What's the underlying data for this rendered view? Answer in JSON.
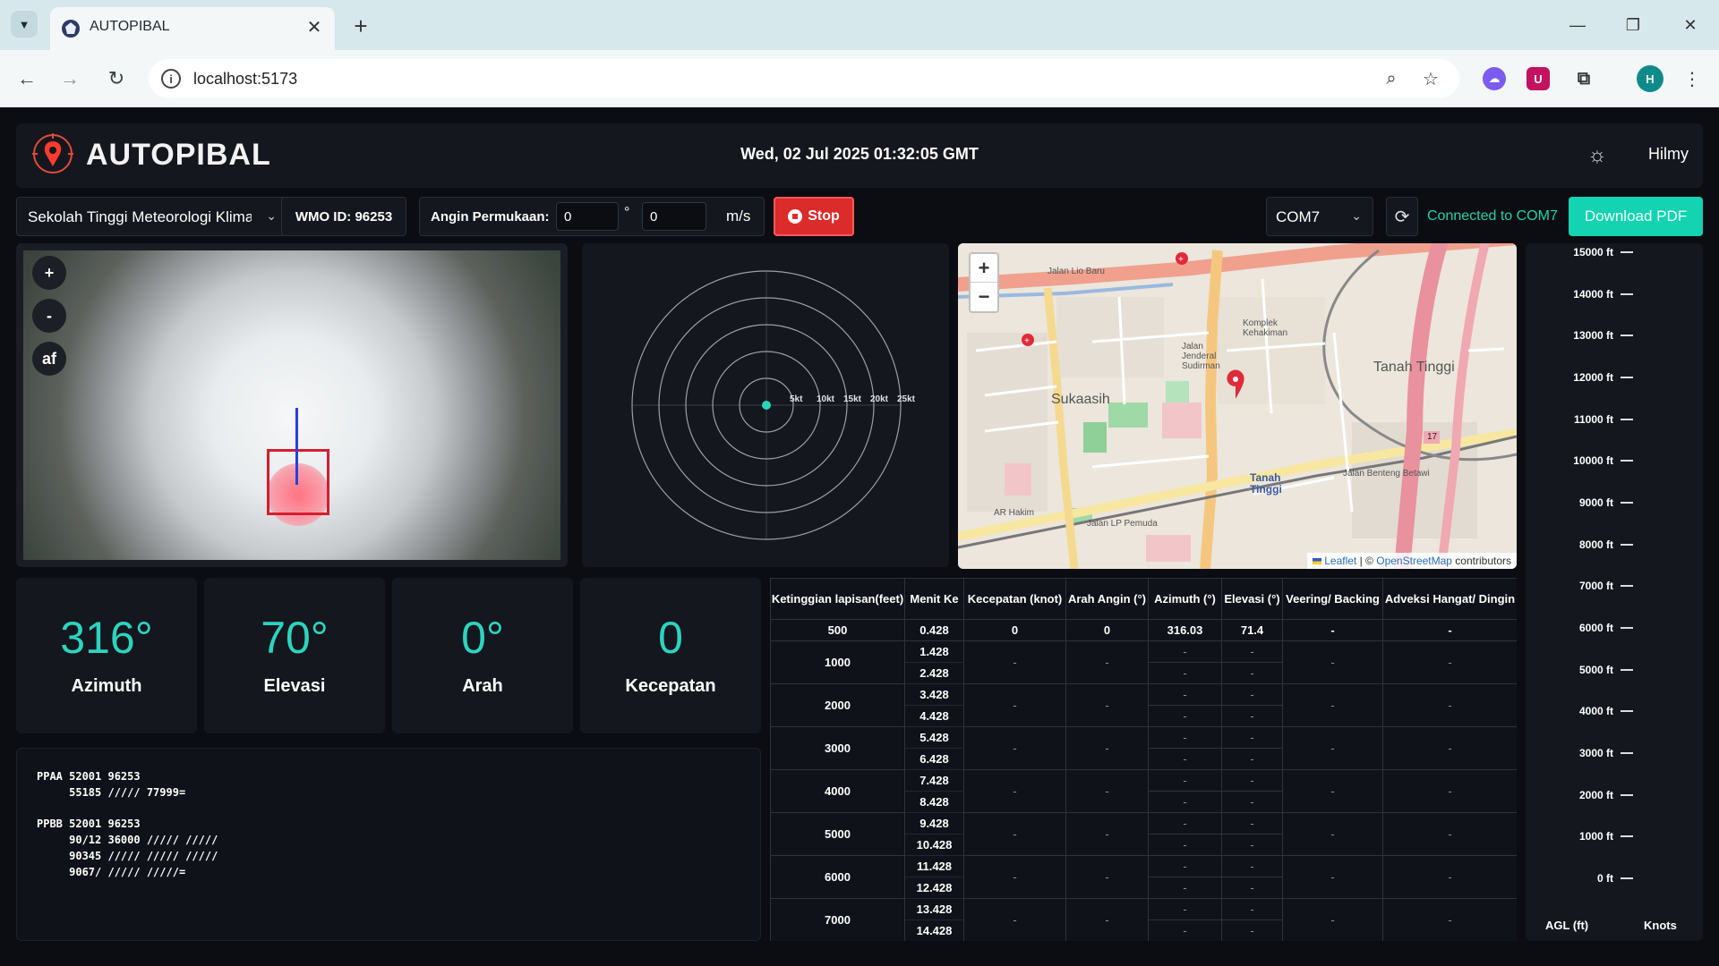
{
  "browser": {
    "tab_title": "AUTOPIBAL",
    "url": "localhost:5173",
    "profile_initial": "H",
    "ext_initial": "U"
  },
  "header": {
    "app_name": "AUTOPIBAL",
    "datetime": "Wed, 02 Jul 2025 01:32:05 GMT",
    "user": "Hilmy"
  },
  "controls": {
    "station": "Sekolah Tinggi Meteorologi Klimatologi dan Geofisika",
    "wmo_id": "WMO ID: 96253",
    "wind_label": "Angin Permukaan:",
    "wind_dir": "0",
    "deg_symbol": "°",
    "wind_speed": "0",
    "wind_unit": "m/s",
    "stop_label": "Stop",
    "com_port": "COM7",
    "connection_status": "Connected to COM7",
    "download_label": "Download PDF"
  },
  "camera": {
    "zoom_in": "+",
    "zoom_out": "-",
    "autofocus": "af"
  },
  "polar": {
    "rings": [
      "5kt",
      "10kt",
      "15kt",
      "20kt",
      "25kt"
    ],
    "point": {
      "speed_kt": 0,
      "direction_deg": 0
    }
  },
  "map": {
    "attribution_leaflet": "Leaflet",
    "attribution_sep": " | © ",
    "attribution_osm": "OpenStreetMap",
    "attribution_tail": " contributors",
    "labels": {
      "jalan_lio_baru": "Jalan Lio Baru",
      "sukaasih": "Sukaasih",
      "tanah_tinggi": "Tanah Tinggi",
      "tanah_tinggi_station": "Tanah Tinggi",
      "jalan_benteng_betawi": "Jalan Benteng Betawi",
      "jalan_jenderal_sudirman": "Jalan Jenderal Sudirman",
      "kompleks": "Komplek Kehakiman",
      "ar_hakim": "AR Hakim",
      "jalan_lp_pemuda": "Jalan LP Pemuda",
      "route_17": "17"
    }
  },
  "stats": [
    {
      "value": "316°",
      "label": "Azimuth"
    },
    {
      "value": "70°",
      "label": "Elevasi"
    },
    {
      "value": "0°",
      "label": "Arah"
    },
    {
      "value": "0",
      "label": "Kecepatan"
    }
  ],
  "code_lines": [
    "PPAA 52001 96253",
    "     55185 ///// 77999=",
    "PPBB 52001 96253",
    "     90/12 36000 ///// /////",
    "     90345 ///// ///// /////",
    "     9067/ ///// /////="
  ],
  "table": {
    "headers": [
      "Ketinggian lapisan(feet)",
      "Menit Ke",
      "Kecepatan (knot)",
      "Arah Angin (°)",
      "Azimuth (°)",
      "Elevasi (°)",
      "Veering/ Backing",
      "Adveksi Hangat/ Dingin"
    ],
    "first_row": [
      "500",
      "0.428",
      "0",
      "0",
      "316.03",
      "71.4",
      "-",
      "-"
    ],
    "groups": [
      {
        "height": "1000",
        "minutes": [
          "1.428",
          "2.428"
        ]
      },
      {
        "height": "2000",
        "minutes": [
          "3.428",
          "4.428"
        ]
      },
      {
        "height": "3000",
        "minutes": [
          "5.428",
          "6.428"
        ]
      },
      {
        "height": "4000",
        "minutes": [
          "7.428",
          "8.428"
        ]
      },
      {
        "height": "5000",
        "minutes": [
          "9.428",
          "10.428"
        ]
      },
      {
        "height": "6000",
        "minutes": [
          "11.428",
          "12.428"
        ]
      },
      {
        "height": "7000",
        "minutes": [
          "13.428",
          "14.428"
        ]
      }
    ],
    "placeholder": "-"
  },
  "altitude": {
    "levels": [
      "15000 ft",
      "14000 ft",
      "13000 ft",
      "12000 ft",
      "11000 ft",
      "10000 ft",
      "9000 ft",
      "8000 ft",
      "7000 ft",
      "6000 ft",
      "5000 ft",
      "4000 ft",
      "3000 ft",
      "2000 ft",
      "1000 ft",
      "0 ft"
    ],
    "x_label": "AGL (ft)",
    "y_label": "Knots"
  },
  "colors": {
    "accent": "#2dd4bf",
    "danger": "#dc2b2b",
    "download": "#13d3b0",
    "panel": "#14171e"
  }
}
